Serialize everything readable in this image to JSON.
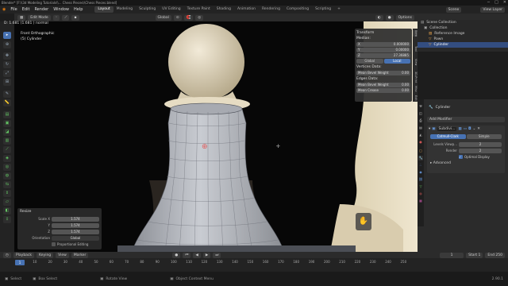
{
  "window": {
    "title": "Blender* [F:\\\\3d Modeling Tutorials\\\\... Chess Pieces\\\\Chess Pieces.blend]",
    "controls": [
      "─",
      "□",
      "✕"
    ]
  },
  "menu": {
    "items": [
      "File",
      "Edit",
      "Render",
      "Window",
      "Help"
    ],
    "workspaces": [
      "Layout",
      "Modeling",
      "Sculpting",
      "UV Editing",
      "Texture Paint",
      "Shading",
      "Animation",
      "Rendering",
      "Compositing",
      "Scripting",
      "+"
    ],
    "active_workspace": "Layout",
    "scene_label": "Scene",
    "view_layer_label": "View Layer"
  },
  "viewport_header": {
    "mode": "Edit Mode",
    "orientation": "Global",
    "options": "Options"
  },
  "info_line": "D: 1.681 (1.681 ) normal",
  "viewport_overlay": {
    "view_name": "Front Orthographic",
    "object_name": "(5) Cylinder"
  },
  "npanel": {
    "title": "Transform",
    "median_label": "Median:",
    "fields": [
      {
        "label": "X",
        "value": "0.000000"
      },
      {
        "label": "Y",
        "value": "0.00000"
      },
      {
        "label": "Z",
        "value": "27.36885"
      }
    ],
    "space_buttons": [
      "Global",
      "Local"
    ],
    "active_space": "Local",
    "vertices_label": "Vertices Data:",
    "vertex_fields": [
      {
        "label": "Mean Bevel Weight",
        "value": "0.00"
      }
    ],
    "edges_label": "Edges Data:",
    "edge_fields": [
      {
        "label": "Mean Bevel Weight",
        "value": "0.00"
      },
      {
        "label": "Mean Crease",
        "value": "0.00"
      }
    ],
    "tabs": [
      "Item",
      "Tool",
      "View",
      "3D-Print",
      "Misc",
      "Edit"
    ]
  },
  "resize_panel": {
    "title": "Resize",
    "scale_fields": [
      {
        "label": "Scale X",
        "value": "1.574"
      },
      {
        "label": "Y",
        "value": "1.574"
      },
      {
        "label": "Z",
        "value": "1.574"
      }
    ],
    "orientation_label": "Orientation",
    "orientation_value": "Global",
    "proportional_label": "Proportional Editing"
  },
  "outliner": {
    "rows": [
      {
        "label": "Scene Collection",
        "selected": false
      },
      {
        "label": "Collection",
        "selected": false
      },
      {
        "label": "Reference Image",
        "selected": false
      },
      {
        "label": "Pawn",
        "selected": false
      },
      {
        "label": "Cylinder",
        "selected": true
      }
    ]
  },
  "properties": {
    "object_name": "Cylinder",
    "add_modifier_label": "Add Modifier",
    "modifier": {
      "name": "Subdivi...",
      "types": [
        "Catmull-Clark",
        "Simple"
      ],
      "active_type": "Catmull-Clark",
      "levels": [
        {
          "label": "Levels Viewp...",
          "value": "2"
        },
        {
          "label": "Render",
          "value": "2"
        }
      ],
      "optimal_display_label": "Optimal Display",
      "advanced_label": "Advanced"
    }
  },
  "timeline": {
    "menus": [
      "Playback",
      "Keying",
      "View",
      "Marker"
    ],
    "current_frame": "1",
    "start_label": "Start",
    "start_value": "1",
    "end_label": "End",
    "end_value": "250",
    "ticks": [
      "0",
      "10",
      "20",
      "30",
      "40",
      "50",
      "60",
      "70",
      "80",
      "90",
      "100",
      "110",
      "120",
      "130",
      "140",
      "150",
      "160",
      "170",
      "180",
      "190",
      "200",
      "210",
      "220",
      "230",
      "240",
      "250"
    ]
  },
  "statusbar": {
    "items": [
      "Select",
      "Box Select",
      "Rotate View",
      "Object Context Menu"
    ],
    "version": "2.90.1"
  },
  "colors": {
    "accent": "#4772b3",
    "header": "#2b2b2b",
    "viewport_bg": "#070707"
  }
}
